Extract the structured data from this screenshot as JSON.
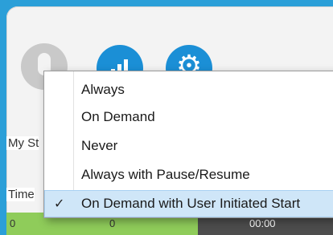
{
  "background_labels": {
    "my_stats": "My St",
    "time": "Time",
    "bottom_left": "0",
    "bottom_mid": "0",
    "bottom_right": "00:00"
  },
  "icons": {
    "person": "person-icon",
    "stats": "bar-chart-icon",
    "settings": "gear-icon"
  },
  "menu": {
    "items": [
      {
        "label": "Always",
        "checked": false
      },
      {
        "label": "On Demand",
        "checked": false
      },
      {
        "label": "Never",
        "checked": false
      },
      {
        "label": "Always with Pause/Resume",
        "checked": false
      },
      {
        "label": "On Demand with User Initiated Start",
        "checked": true
      }
    ],
    "check_glyph": "✓"
  },
  "colors": {
    "frame": "#2b9fd8",
    "icon_blue": "#1b8fd6",
    "selected_bg": "#cfe6f8",
    "status_green": "#8fcc5a",
    "status_dark": "#4d4d4d"
  }
}
